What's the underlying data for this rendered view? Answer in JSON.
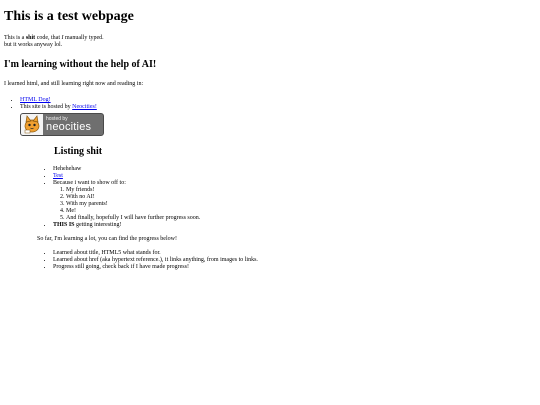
{
  "title": "This is a test webpage",
  "intro": {
    "t1": "This is a ",
    "bold": "shit",
    "t2": " code, that ",
    "italic": "I",
    "t3": " manually typed.",
    "line2": "but it works anyway lol."
  },
  "heading_learning": "I'm learning without the help of AI!",
  "learning_text": "I learned html, and still learning right now and reading in:",
  "links": {
    "html_dog": "HTML Dog!",
    "hosted_prefix": "This site is hosted by ",
    "neocities": "Neocities!"
  },
  "badge": {
    "small": "hosted by",
    "big": "neocities"
  },
  "listing_heading": "Listing shit",
  "list": {
    "item1": "Hehehehaw",
    "item2": "Test",
    "item3": "Because i want to show off to:",
    "friends": [
      "My friends!",
      "With no AI!",
      "With my parents!",
      "Me!",
      "And finally, hopefully I will have further progress soon."
    ],
    "item4_bold": "THIS IS",
    "item4_rest": " getting interesting!"
  },
  "progress_text": "So far, I'm learning a lot, you can find the progress below!",
  "progress": [
    "Learned about title, HTML5 what stands for.",
    "Learned about href (aka hypertext reference.), it links anything, from images to links.",
    "Progress still going, check back if I have made progress!"
  ]
}
